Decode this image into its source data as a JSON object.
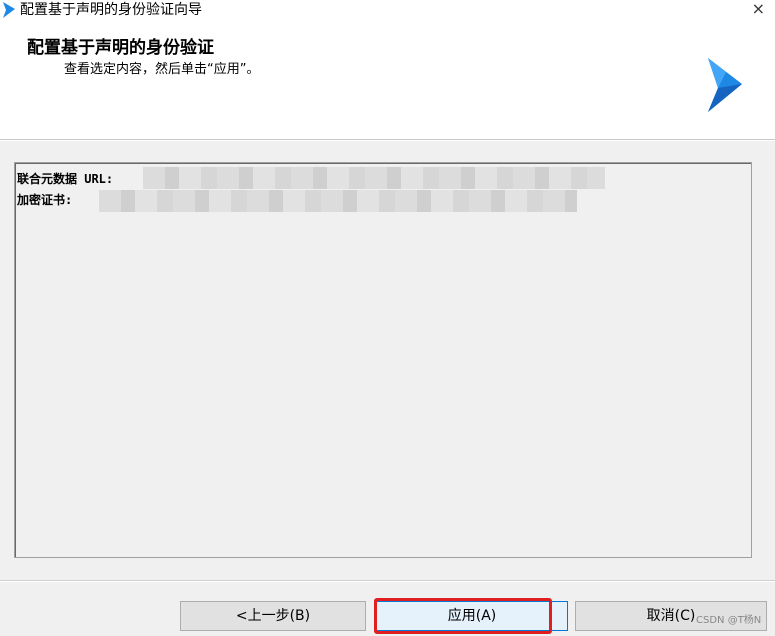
{
  "window": {
    "title": "配置基于声明的身份验证向导",
    "close_glyph": "×"
  },
  "header": {
    "heading": "配置基于声明的身份验证",
    "subheading": "查看选定内容，然后单击“应用”。"
  },
  "content": {
    "fields": [
      {
        "label": "联合元数据 URL:"
      },
      {
        "label": "加密证书:"
      }
    ]
  },
  "buttons": {
    "back": "<上一步(B)",
    "apply": "应用(A)",
    "cancel": "取消(C)"
  },
  "watermark": "CSDN @T杨N",
  "colors": {
    "accent": "#0078d7",
    "highlight": "#e02020",
    "logo": "#1e88e5"
  }
}
